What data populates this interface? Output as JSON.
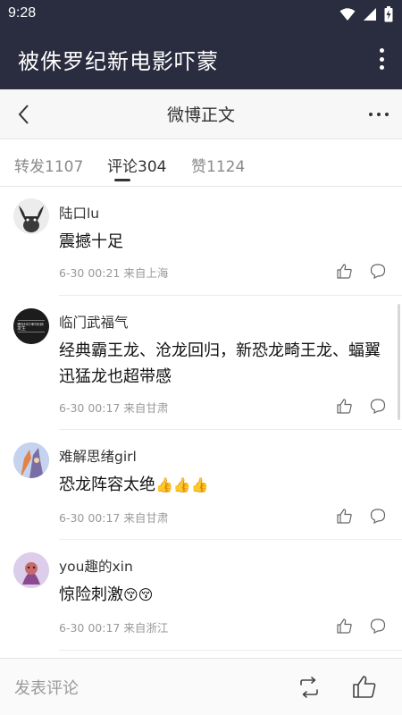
{
  "status_bar": {
    "time": "9:28"
  },
  "app_bar": {
    "title": "被侏罗纪新电影吓蒙"
  },
  "nav": {
    "title": "微博正文"
  },
  "tabs": [
    {
      "label": "转发1107",
      "active": false
    },
    {
      "label": "评论304",
      "active": true
    },
    {
      "label": "赞1124",
      "active": false
    }
  ],
  "comments": [
    {
      "name": "陆口lu",
      "text": "震撼十足",
      "meta": "6-30 00:21 来自上海"
    },
    {
      "name": "临门武福气",
      "text": "经典霸王龙、沧龙回归，新恐龙畸王龙、蝠翼迅猛龙也超带感",
      "meta": "6-30 00:17 来自甘肃",
      "avatar_text": "美好的事情会发生"
    },
    {
      "name": "难解思绪girl",
      "text": "恐龙阵容太绝",
      "emoji": "👍👍👍",
      "meta": "6-30 00:17 来自甘肃"
    },
    {
      "name": "you趣的xin",
      "text": "惊险刺激",
      "emoji": "😚😚",
      "meta": "6-30 00:17 来自浙江"
    }
  ],
  "bottom_bar": {
    "comment_prompt": "发表评论"
  },
  "icons": [
    "wifi-icon",
    "signal-icon",
    "battery-icon",
    "overflow-icon",
    "back-icon",
    "more-icon",
    "like-icon",
    "reply-icon",
    "repost-icon"
  ],
  "colors": {
    "header_bg": "#2a2c3f",
    "nav_bg": "#f7f7f7",
    "text_primary": "#111111",
    "text_muted": "#999999"
  }
}
